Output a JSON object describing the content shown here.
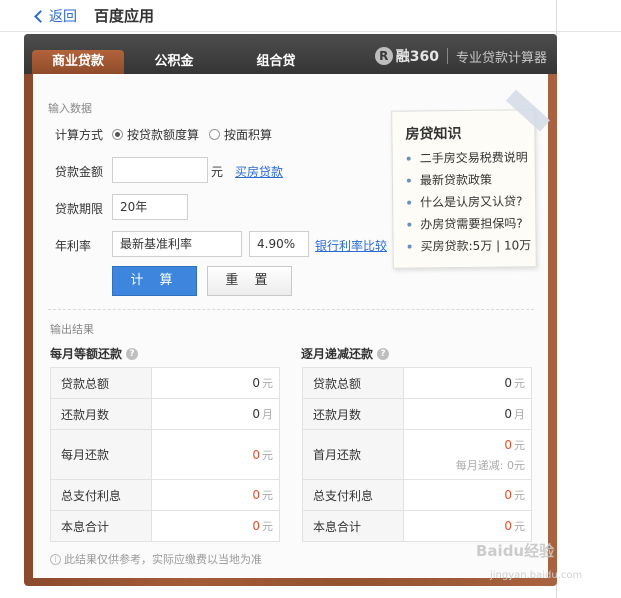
{
  "nav": {
    "back_label": "返回",
    "title": "百度应用"
  },
  "tabs": [
    {
      "label": "商业贷款",
      "active": true
    },
    {
      "label": "公积金",
      "active": false
    },
    {
      "label": "组合贷",
      "active": false
    }
  ],
  "brand": {
    "logo_char": "R",
    "name": "融360",
    "slogan": "专业贷款计算器"
  },
  "input_section": {
    "title": "输入数据",
    "method_label": "计算方式",
    "method_options": [
      {
        "label": "按贷款额度算",
        "selected": true
      },
      {
        "label": "按面积算",
        "selected": false
      }
    ],
    "amount_label": "贷款金额",
    "amount_value": "",
    "amount_unit": "元",
    "buy_house_link": "买房贷款",
    "term_label": "贷款期限",
    "term_value": "20年",
    "rate_label": "年利率",
    "rate_type": "最新基准利率",
    "rate_value": "4.90%",
    "compare_link": "银行利率比较",
    "calc_button": "计 算",
    "reset_button": "重 置"
  },
  "knowledge": {
    "title": "房贷知识",
    "items": [
      "二手房交易税费说明",
      "最新贷款政策",
      "什么是认房又认贷?",
      "办房贷需要担保吗?",
      "买房贷款:5万 | 10万"
    ]
  },
  "output_section": {
    "title": "输出结果",
    "equal_payment": {
      "title": "每月等额还款",
      "rows": [
        {
          "label": "贷款总额",
          "value": "0",
          "unit": "元",
          "highlight": false
        },
        {
          "label": "还款月数",
          "value": "0",
          "unit": "月",
          "highlight": false
        },
        {
          "label": "每月还款",
          "value": "0",
          "unit": "元",
          "highlight": true
        },
        {
          "label": "总支付利息",
          "value": "0",
          "unit": "元",
          "highlight": true
        },
        {
          "label": "本息合计",
          "value": "0",
          "unit": "元",
          "highlight": true
        }
      ]
    },
    "decreasing_payment": {
      "title": "逐月递减还款",
      "rows": [
        {
          "label": "贷款总额",
          "value": "0",
          "unit": "元",
          "highlight": false
        },
        {
          "label": "还款月数",
          "value": "0",
          "unit": "月",
          "highlight": false
        },
        {
          "label": "首月还款",
          "value": "0",
          "unit": "元",
          "highlight": true,
          "sub": "每月递减: 0",
          "sub_unit": "元"
        },
        {
          "label": "总支付利息",
          "value": "0",
          "unit": "元",
          "highlight": true
        },
        {
          "label": "本息合计",
          "value": "0",
          "unit": "元",
          "highlight": true
        }
      ]
    },
    "note": "此结果仅供参考，实际应缴费以当地为准"
  },
  "watermark": {
    "main": "Baidu经验",
    "sub": "jingyan.baidu.com"
  },
  "colors": {
    "accent": "#3d85dd",
    "tab_active": "#a35d38",
    "highlight": "#e2502b",
    "link": "#2a6bd6"
  }
}
